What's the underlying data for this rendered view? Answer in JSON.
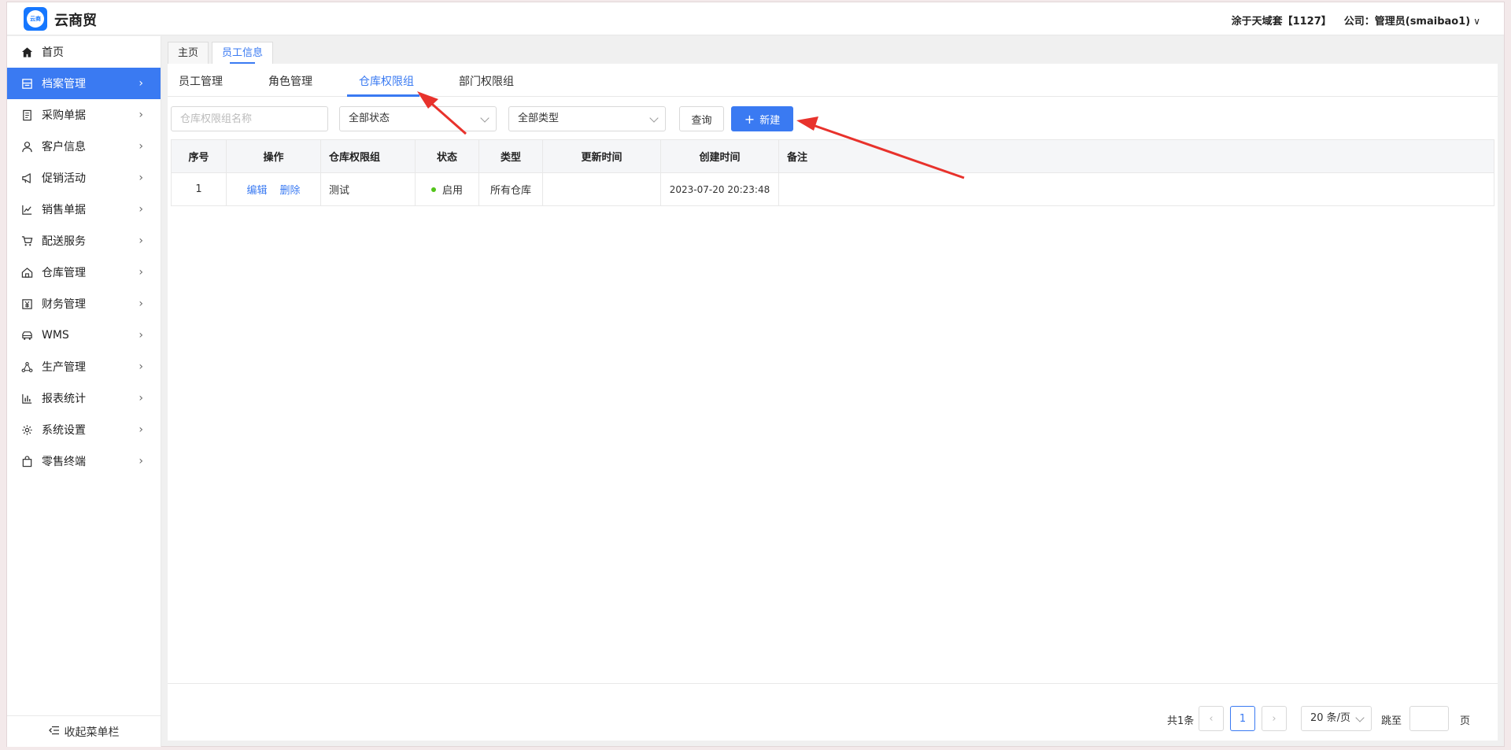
{
  "app": {
    "title": "云商贸",
    "logo_text": "云商"
  },
  "header": {
    "account": "涂于天域套【1127】",
    "company": "公司：管理员(smaibao1)",
    "caret": "∨"
  },
  "sidebar": {
    "items": [
      {
        "label": "首页",
        "icon": "home-icon",
        "has_arrow": false,
        "active": false
      },
      {
        "label": "档案管理",
        "icon": "archive-icon",
        "has_arrow": true,
        "active": true
      },
      {
        "label": "采购单据",
        "icon": "document-icon",
        "has_arrow": true,
        "active": false
      },
      {
        "label": "客户信息",
        "icon": "user-icon",
        "has_arrow": true,
        "active": false
      },
      {
        "label": "促销活动",
        "icon": "megaphone-icon",
        "has_arrow": true,
        "active": false
      },
      {
        "label": "销售单据",
        "icon": "line-chart-icon",
        "has_arrow": true,
        "active": false
      },
      {
        "label": "配送服务",
        "icon": "cart-icon",
        "has_arrow": true,
        "active": false
      },
      {
        "label": "仓库管理",
        "icon": "warehouse-icon",
        "has_arrow": true,
        "active": false
      },
      {
        "label": "财务管理",
        "icon": "finance-icon",
        "has_arrow": true,
        "active": false
      },
      {
        "label": "WMS",
        "icon": "truck-icon",
        "has_arrow": true,
        "active": false
      },
      {
        "label": "生产管理",
        "icon": "network-icon",
        "has_arrow": true,
        "active": false
      },
      {
        "label": "报表统计",
        "icon": "bar-chart-icon",
        "has_arrow": true,
        "active": false
      },
      {
        "label": "系统设置",
        "icon": "gear-icon",
        "has_arrow": true,
        "active": false
      },
      {
        "label": "零售终端",
        "icon": "bag-icon",
        "has_arrow": true,
        "active": false
      }
    ],
    "collapse_label": "收起菜单栏"
  },
  "page_tabs": [
    {
      "label": "主页",
      "active": false
    },
    {
      "label": "员工信息",
      "active": true
    }
  ],
  "subtabs": [
    {
      "label": "员工管理",
      "active": false
    },
    {
      "label": "角色管理",
      "active": false
    },
    {
      "label": "仓库权限组",
      "active": true
    },
    {
      "label": "部门权限组",
      "active": false
    }
  ],
  "filters": {
    "name_placeholder": "仓库权限组名称",
    "status_select": "全部状态",
    "type_select": "全部类型",
    "query_button": "查询",
    "new_button": "新建",
    "new_icon": "+"
  },
  "table": {
    "columns": [
      "序号",
      "操作",
      "仓库权限组",
      "状态",
      "类型",
      "更新时间",
      "创建时间",
      "备注"
    ],
    "rows": [
      {
        "index": "1",
        "actions": [
          "编辑",
          "删除"
        ],
        "group": "测试",
        "status": "启用",
        "type": "所有仓库",
        "updated": "",
        "created": "2023-07-20 20:23:48",
        "remark": ""
      }
    ]
  },
  "pagination": {
    "total": "共1条",
    "current_page": "1",
    "page_size": "20 条/页",
    "jump_label": "跳至",
    "page_suffix": "页",
    "prev": "‹",
    "next": "›"
  },
  "colors": {
    "accent": "#3a7af2",
    "annotation": "#e8322c",
    "status_on": "#52c41a"
  }
}
